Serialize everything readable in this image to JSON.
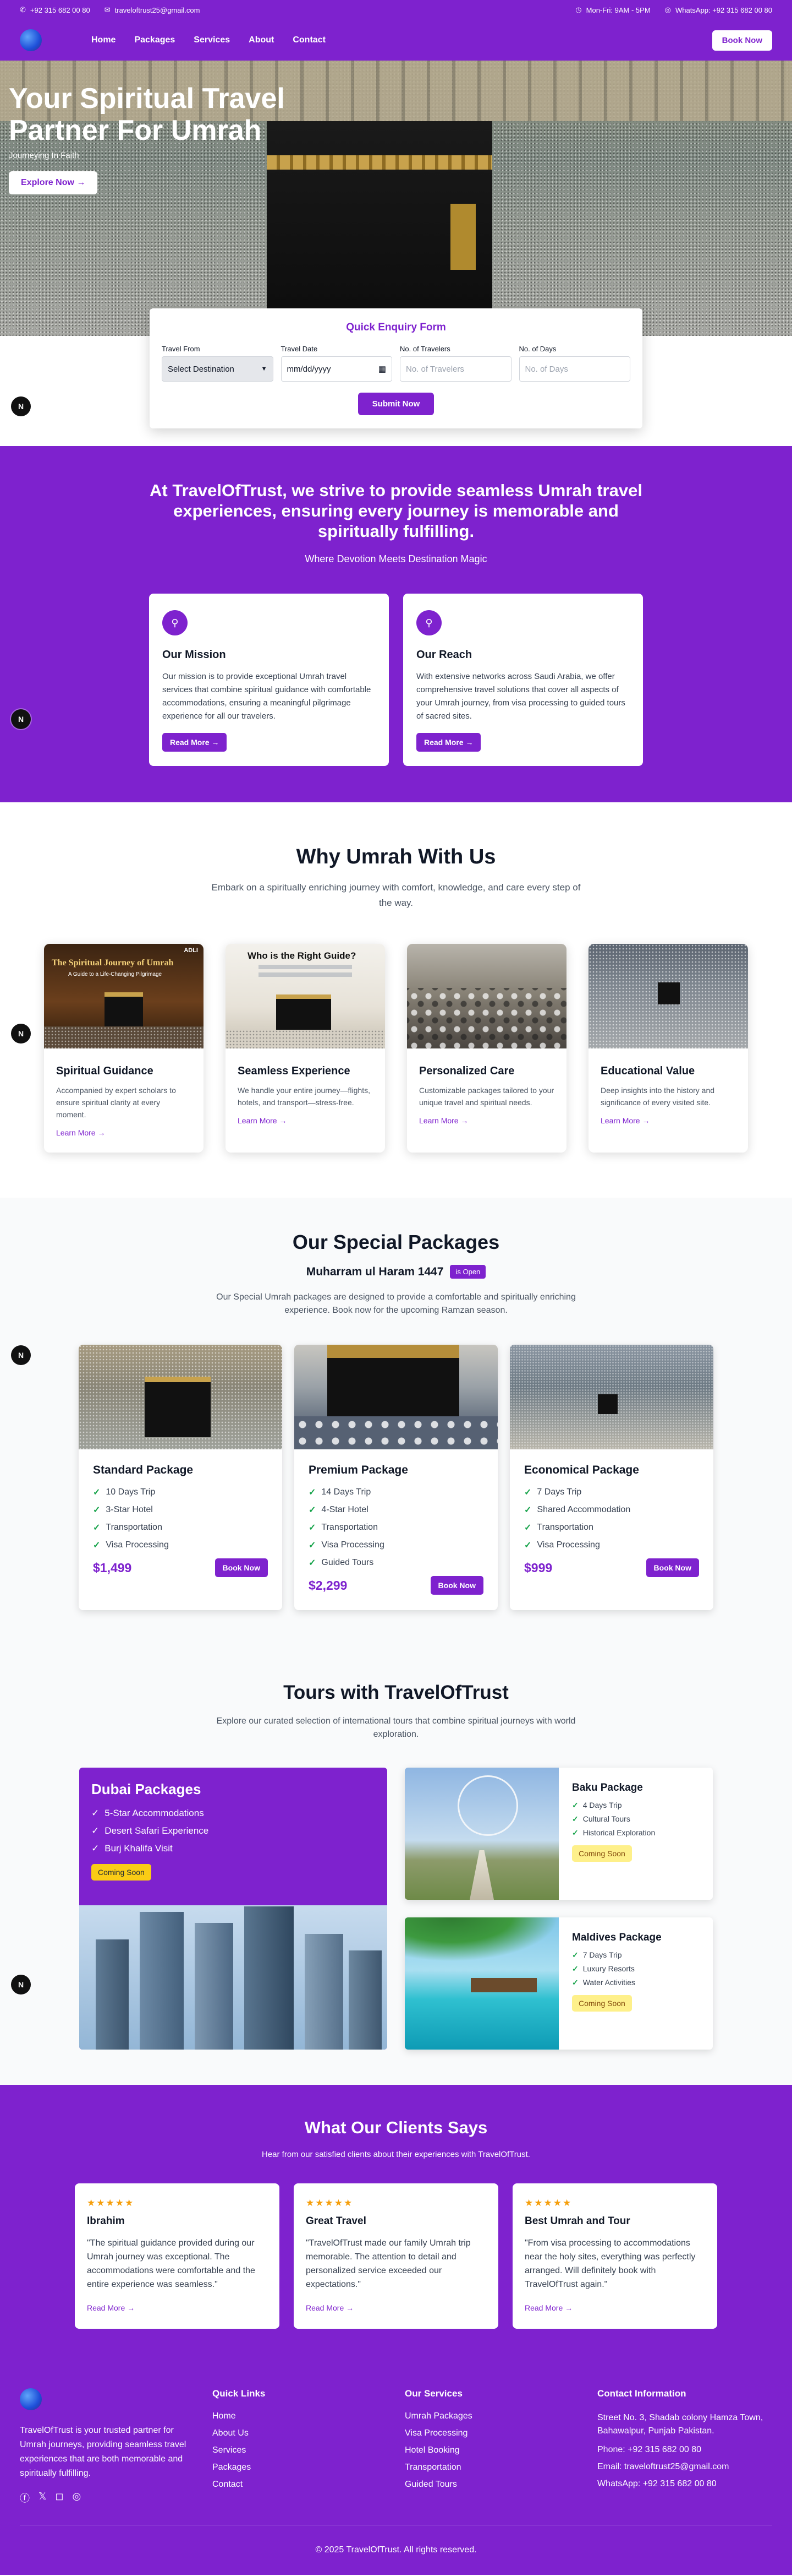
{
  "topbar": {
    "phone": "+92 315 682 00 80",
    "email": "traveloftrust25@gmail.com",
    "hours": "Mon-Fri: 9AM - 5PM",
    "whatsapp": "WhatsApp: +92 315 682 00 80"
  },
  "nav": {
    "items": [
      "Home",
      "Packages",
      "Services",
      "About",
      "Contact"
    ],
    "cta": "Book Now"
  },
  "hero": {
    "title": "Your Spiritual Travel Partner For Umrah",
    "subtitle": "Journeying In Faith",
    "cta": "Explore Now"
  },
  "enquiry": {
    "title": "Quick Enquiry Form",
    "labels": [
      "Travel From",
      "Travel Date",
      "No. of Travelers",
      "No. of Days"
    ],
    "select_value": "Select Destination",
    "date_value": "mm/dd/yyyy",
    "travelers_placeholder": "No. of Travelers",
    "days_placeholder": "No. of Days",
    "submit": "Submit Now"
  },
  "float_badge": "N",
  "mission": {
    "heading": "At TravelOfTrust, we strive to provide seamless Umrah travel experiences, ensuring every journey is memorable and spiritually fulfilling.",
    "tagline": "Where Devotion Meets Destination Magic",
    "cards": [
      {
        "title": "Our Mission",
        "text": "Our mission is to provide exceptional Umrah travel services that combine spiritual guidance with comfortable accommodations, ensuring a meaningful pilgrimage experience for all our travelers.",
        "cta": "Read More"
      },
      {
        "title": "Our Reach",
        "text": "With extensive networks across Saudi Arabia, we offer comprehensive travel solutions that cover all aspects of your Umrah journey, from visa processing to guided tours of sacred sites.",
        "cta": "Read More"
      }
    ]
  },
  "why": {
    "title": "Why Umrah With Us",
    "lead": "Embark on a spiritually enriching journey with comfort, knowledge, and care every step of the way.",
    "link_label": "Learn More",
    "cards": [
      {
        "title": "Spiritual Guidance",
        "text": "Accompanied by expert scholars to ensure spiritual clarity at every moment.",
        "img_title": "The Spiritual Journey of Umrah",
        "img_sub": "A Guide to a Life-Changing Pilgrimage",
        "img_brand": "ADLI"
      },
      {
        "title": "Seamless Experience",
        "text": "We handle your entire journey—flights, hotels, and transport—stress-free.",
        "img_title": "Who is the Right Guide?"
      },
      {
        "title": "Personalized Care",
        "text": "Customizable packages tailored to your unique travel and spiritual needs."
      },
      {
        "title": "Educational Value",
        "text": "Deep insights into the history and significance of every visited site."
      }
    ]
  },
  "packages": {
    "title": "Our Special Packages",
    "season": "Muharram ul Haram 1447",
    "status": "is Open",
    "lead": "Our Special Umrah packages are designed to provide a comfortable and spiritually enriching experience. Book now for the upcoming Ramzan season.",
    "cta": "Book Now",
    "cards": [
      {
        "title": "Standard Package",
        "features": [
          "10 Days Trip",
          "3-Star Hotel",
          "Transportation",
          "Visa Processing"
        ],
        "price": "$1,499"
      },
      {
        "title": "Premium Package",
        "features": [
          "14 Days Trip",
          "4-Star Hotel",
          "Transportation",
          "Visa Processing",
          "Guided Tours"
        ],
        "price": "$2,299"
      },
      {
        "title": "Economical Package",
        "features": [
          "7 Days Trip",
          "Shared Accommodation",
          "Transportation",
          "Visa Processing"
        ],
        "price": "$999"
      }
    ]
  },
  "tours": {
    "title": "Tours with TravelOfTrust",
    "lead": "Explore our curated selection of international tours that combine spiritual journeys with world exploration.",
    "soon": "Coming Soon",
    "dubai": {
      "title": "Dubai Packages",
      "features": [
        "5-Star Accommodations",
        "Desert Safari Experience",
        "Burj Khalifa Visit"
      ]
    },
    "cards": [
      {
        "title": "Baku Package",
        "features": [
          "4 Days Trip",
          "Cultural Tours",
          "Historical Exploration"
        ]
      },
      {
        "title": "Maldives Package",
        "features": [
          "7 Days Trip",
          "Luxury Resorts",
          "Water Activities"
        ]
      }
    ]
  },
  "testimonials": {
    "title": "What Our Clients Says",
    "lead": "Hear from our satisfied clients about their experiences with TravelOfTrust.",
    "stars": "★★★★★",
    "link_label": "Read More",
    "cards": [
      {
        "name": "Ibrahim",
        "text": "\"The spiritual guidance provided during our Umrah journey was exceptional. The accommodations were comfortable and the entire experience was seamless.\""
      },
      {
        "name": "Great Travel",
        "text": "\"TravelOfTrust made our family Umrah trip memorable. The attention to detail and personalized service exceeded our expectations.\""
      },
      {
        "name": "Best Umrah and Tour",
        "text": "\"From visa processing to accommodations near the holy sites, everything was perfectly arranged. Will definitely book with TravelOfTrust again.\""
      }
    ]
  },
  "footer": {
    "about": "TravelOfTrust is your trusted partner for Umrah journeys, providing seamless travel experiences that are both memorable and spiritually fulfilling.",
    "quick_title": "Quick Links",
    "quick_links": [
      "Home",
      "About Us",
      "Services",
      "Packages",
      "Contact"
    ],
    "services_title": "Our Services",
    "services": [
      "Umrah Packages",
      "Visa Processing",
      "Hotel Booking",
      "Transportation",
      "Guided Tours"
    ],
    "contact_title": "Contact Information",
    "address": "Street No. 3, Shadab colony Hamza Town, Bahawalpur, Punjab Pakistan.",
    "phone": "Phone: +92 315 682 00 80",
    "email": "Email: traveloftrust25@gmail.com",
    "whatsapp": "WhatsApp: +92 315 682 00 80",
    "copyright": "© 2025 TravelOfTrust. All rights reserved."
  },
  "colors": {
    "primary": "#7e22ce",
    "star": "#f59e0b",
    "check": "#16a34a",
    "soon": "#facc15"
  }
}
